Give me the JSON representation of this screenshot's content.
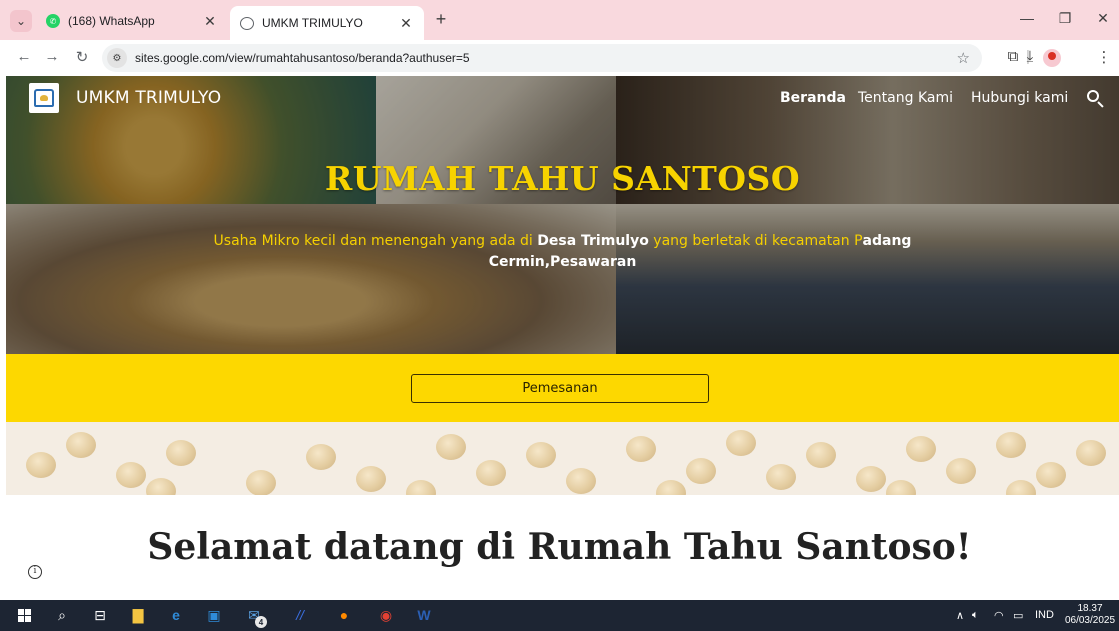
{
  "browser": {
    "tabs": [
      {
        "title": "(168) WhatsApp",
        "icon": "whatsapp-icon",
        "active": false
      },
      {
        "title": "UMKM TRIMULYO",
        "icon": "globe-icon",
        "active": true
      }
    ],
    "url": "sites.google.com/view/rumahtahusantoso/beranda?authuser=5"
  },
  "site": {
    "title": "UMKM TRIMULYO",
    "nav": [
      {
        "label": "Beranda",
        "current": true
      },
      {
        "label": "Tentang Kami",
        "current": false
      },
      {
        "label": "Hubungi kami",
        "current": false
      }
    ]
  },
  "hero": {
    "title": "RUMAH TAHU SANTOSO",
    "subtitle_part1": "Usaha Mikro kecil dan menengah yang ada di ",
    "subtitle_bold1": "Desa Trimulyo",
    "subtitle_part2": " yang berletak di kecamatan P",
    "subtitle_bold2": "adang Cermin,Pesawaran",
    "accent_color": "#f7d300"
  },
  "cta": {
    "label": "Pemesanan",
    "band_color": "#fdd800"
  },
  "welcome": {
    "heading": "Selamat datang di Rumah Tahu Santoso!"
  },
  "taskbar": {
    "tray_language": "IND",
    "time": "18.37",
    "date": "06/03/2025",
    "badge_count": "4"
  }
}
